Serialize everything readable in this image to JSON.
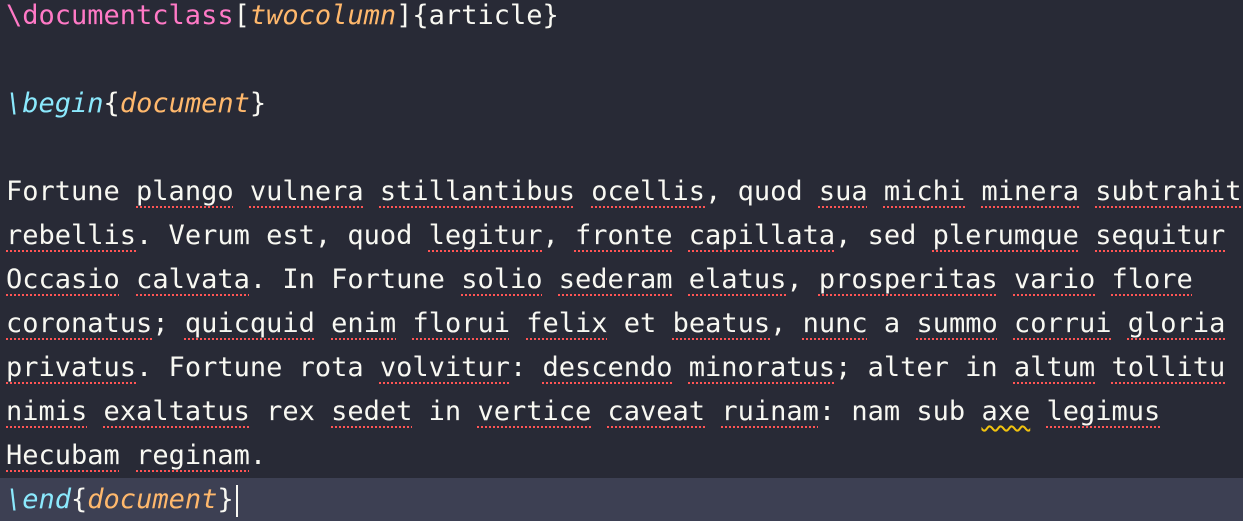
{
  "editor": {
    "language": "latex",
    "lines": [
      {
        "kind": "preamble",
        "segments": [
          {
            "text": "\\documentclass",
            "cls": "tok-cmd"
          },
          {
            "text": "[",
            "cls": "tok-bracket"
          },
          {
            "text": "twocolumn",
            "cls": "tok-opt"
          },
          {
            "text": "]",
            "cls": "tok-bracket"
          },
          {
            "text": "{article}",
            "cls": "tok-arg"
          }
        ]
      },
      {
        "kind": "blank",
        "segments": []
      },
      {
        "kind": "begin",
        "segments": [
          {
            "text": "\\begin",
            "cls": "tok-env-cmd"
          },
          {
            "text": "{",
            "cls": "tok-bracket"
          },
          {
            "text": "document",
            "cls": "tok-env-name"
          },
          {
            "text": "}",
            "cls": "tok-bracket"
          }
        ]
      },
      {
        "kind": "blank",
        "segments": []
      },
      {
        "kind": "text",
        "segments": [
          {
            "text": "Fortune ",
            "cls": "w"
          },
          {
            "text": "plango",
            "cls": "spell"
          },
          {
            "text": " ",
            "cls": "w"
          },
          {
            "text": "vulnera",
            "cls": "spell"
          },
          {
            "text": " ",
            "cls": "w"
          },
          {
            "text": "stillantibus",
            "cls": "spell"
          },
          {
            "text": " ",
            "cls": "w"
          },
          {
            "text": "ocellis",
            "cls": "spell"
          },
          {
            "text": ", quod ",
            "cls": "w"
          },
          {
            "text": "sua",
            "cls": "spell"
          },
          {
            "text": " ",
            "cls": "w"
          },
          {
            "text": "michi",
            "cls": "spell"
          },
          {
            "text": " ",
            "cls": "w"
          },
          {
            "text": "minera",
            "cls": "spell"
          },
          {
            "text": " ",
            "cls": "w"
          },
          {
            "text": "subtrahit",
            "cls": "spell"
          }
        ]
      },
      {
        "kind": "text",
        "segments": [
          {
            "text": "rebellis",
            "cls": "spell"
          },
          {
            "text": ". Verum est, quod ",
            "cls": "w"
          },
          {
            "text": "legitur",
            "cls": "spell"
          },
          {
            "text": ", ",
            "cls": "w"
          },
          {
            "text": "fronte",
            "cls": "spell"
          },
          {
            "text": " ",
            "cls": "w"
          },
          {
            "text": "capillata",
            "cls": "spell"
          },
          {
            "text": ", sed ",
            "cls": "w"
          },
          {
            "text": "plerumque",
            "cls": "spell"
          },
          {
            "text": " ",
            "cls": "w"
          },
          {
            "text": "sequitur",
            "cls": "spell"
          }
        ]
      },
      {
        "kind": "text",
        "segments": [
          {
            "text": "Occasio",
            "cls": "spell"
          },
          {
            "text": " ",
            "cls": "w"
          },
          {
            "text": "calvata",
            "cls": "spell"
          },
          {
            "text": ". In Fortune ",
            "cls": "w"
          },
          {
            "text": "solio",
            "cls": "spell"
          },
          {
            "text": " ",
            "cls": "w"
          },
          {
            "text": "sederam",
            "cls": "spell"
          },
          {
            "text": " ",
            "cls": "w"
          },
          {
            "text": "elatus",
            "cls": "spell"
          },
          {
            "text": ", ",
            "cls": "w"
          },
          {
            "text": "prosperitas",
            "cls": "spell"
          },
          {
            "text": " ",
            "cls": "w"
          },
          {
            "text": "vario",
            "cls": "spell"
          },
          {
            "text": " ",
            "cls": "w"
          },
          {
            "text": "flore",
            "cls": "spell"
          }
        ]
      },
      {
        "kind": "text",
        "segments": [
          {
            "text": "coronatus",
            "cls": "spell"
          },
          {
            "text": "; ",
            "cls": "w"
          },
          {
            "text": "quicquid",
            "cls": "spell"
          },
          {
            "text": " ",
            "cls": "w"
          },
          {
            "text": "enim",
            "cls": "spell"
          },
          {
            "text": " ",
            "cls": "w"
          },
          {
            "text": "florui",
            "cls": "spell"
          },
          {
            "text": " ",
            "cls": "w"
          },
          {
            "text": "felix",
            "cls": "spell"
          },
          {
            "text": " et ",
            "cls": "w"
          },
          {
            "text": "beatus",
            "cls": "spell"
          },
          {
            "text": ", ",
            "cls": "w"
          },
          {
            "text": "nunc",
            "cls": "spell"
          },
          {
            "text": " a ",
            "cls": "w"
          },
          {
            "text": "summo",
            "cls": "spell"
          },
          {
            "text": " ",
            "cls": "w"
          },
          {
            "text": "corrui",
            "cls": "spell"
          },
          {
            "text": " ",
            "cls": "w"
          },
          {
            "text": "gloria",
            "cls": "spell"
          }
        ]
      },
      {
        "kind": "text",
        "segments": [
          {
            "text": "privatus",
            "cls": "spell"
          },
          {
            "text": ". Fortune rota ",
            "cls": "w"
          },
          {
            "text": "volvitur",
            "cls": "spell"
          },
          {
            "text": ": ",
            "cls": "w"
          },
          {
            "text": "descendo",
            "cls": "spell"
          },
          {
            "text": " ",
            "cls": "w"
          },
          {
            "text": "minoratus",
            "cls": "spell"
          },
          {
            "text": "; alter in ",
            "cls": "w"
          },
          {
            "text": "altum",
            "cls": "spell"
          },
          {
            "text": " ",
            "cls": "w"
          },
          {
            "text": "tollitu",
            "cls": "spell"
          }
        ]
      },
      {
        "kind": "text",
        "segments": [
          {
            "text": "nimis",
            "cls": "spell"
          },
          {
            "text": " ",
            "cls": "w"
          },
          {
            "text": "exaltatus",
            "cls": "spell"
          },
          {
            "text": " rex ",
            "cls": "w"
          },
          {
            "text": "sedet",
            "cls": "spell"
          },
          {
            "text": " in ",
            "cls": "w"
          },
          {
            "text": "vertice",
            "cls": "spell"
          },
          {
            "text": " ",
            "cls": "w"
          },
          {
            "text": "caveat",
            "cls": "spell"
          },
          {
            "text": " ",
            "cls": "w"
          },
          {
            "text": "ruinam",
            "cls": "spell"
          },
          {
            "text": ": nam sub ",
            "cls": "w"
          },
          {
            "text": "axe",
            "cls": "grammar"
          },
          {
            "text": " ",
            "cls": "w"
          },
          {
            "text": "legimus",
            "cls": "spell"
          }
        ]
      },
      {
        "kind": "text",
        "segments": [
          {
            "text": "Hecubam",
            "cls": "spell"
          },
          {
            "text": " ",
            "cls": "w"
          },
          {
            "text": "reginam",
            "cls": "spell"
          },
          {
            "text": ".",
            "cls": "w"
          }
        ]
      },
      {
        "kind": "end",
        "current": true,
        "segments": [
          {
            "text": "\\end",
            "cls": "tok-env-cmd"
          },
          {
            "text": "{",
            "cls": "tok-bracket"
          },
          {
            "text": "document",
            "cls": "tok-env-name"
          },
          {
            "text": "}",
            "cls": "tok-bracket"
          }
        ]
      }
    ]
  }
}
